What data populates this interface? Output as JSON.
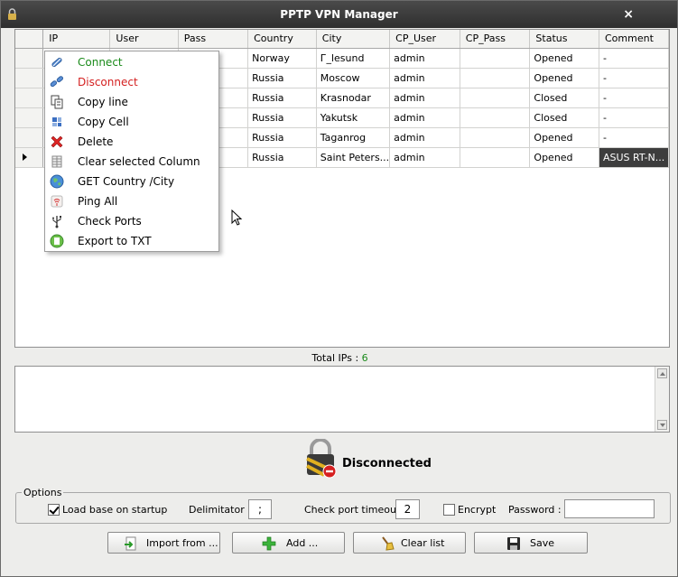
{
  "window": {
    "title": "PPTP VPN Manager",
    "close_glyph": "×"
  },
  "grid": {
    "columns": [
      "IP",
      "User",
      "Pass",
      "Country",
      "City",
      "CP_User",
      "CP_Pass",
      "Status",
      "Comment"
    ],
    "rows": [
      {
        "country": "Norway",
        "city": "Г_lesund",
        "cp_user": "admin",
        "cp_pass": "",
        "status": "Opened",
        "comment": "-"
      },
      {
        "country": "Russia",
        "city": "Moscow",
        "cp_user": "admin",
        "cp_pass": "",
        "status": "Opened",
        "comment": "-"
      },
      {
        "country": "Russia",
        "city": "Krasnodar",
        "cp_user": "admin",
        "cp_pass": "",
        "status": "Closed",
        "comment": "-"
      },
      {
        "country": "Russia",
        "city": "Yakutsk",
        "cp_user": "admin",
        "cp_pass": "",
        "status": "Closed",
        "comment": "-"
      },
      {
        "country": "Russia",
        "city": "Taganrog",
        "cp_user": "admin",
        "cp_pass": "",
        "status": "Opened",
        "comment": "-"
      },
      {
        "country": "Russia",
        "city": "Saint Peters...",
        "cp_user": "admin",
        "cp_pass": "",
        "status": "Opened",
        "comment": "ASUS RT-N..."
      }
    ]
  },
  "context_menu": {
    "items": [
      {
        "label": "Connect",
        "icon": "connect-icon",
        "color": "#1a8a1a"
      },
      {
        "label": "Disconnect",
        "icon": "disconnect-icon",
        "color": "#d42020"
      },
      {
        "label": "Copy line",
        "icon": "copy-line-icon",
        "color": "#000000"
      },
      {
        "label": "Copy Cell",
        "icon": "copy-cell-icon",
        "color": "#000000"
      },
      {
        "label": "Delete",
        "icon": "delete-icon",
        "color": "#000000"
      },
      {
        "label": "Clear selected Column",
        "icon": "clear-column-icon",
        "color": "#000000"
      },
      {
        "label": "GET Country /City",
        "icon": "globe-icon",
        "color": "#000000"
      },
      {
        "label": "Ping All",
        "icon": "ping-icon",
        "color": "#000000"
      },
      {
        "label": "Check Ports",
        "icon": "usb-icon",
        "color": "#000000"
      },
      {
        "label": "Export to TXT",
        "icon": "export-icon",
        "color": "#000000"
      }
    ]
  },
  "summary": {
    "total_label": "Total IPs : ",
    "total_value": "6"
  },
  "status": {
    "text": "Disconnected"
  },
  "options": {
    "legend": "Options",
    "load_base_label": "Load base on startup",
    "load_base_checked": true,
    "delimitator_label": "Delimitator",
    "delimitator_value": ";",
    "timeout_label": "Check port timeout :",
    "timeout_value": "2",
    "encrypt_label": "Encrypt",
    "encrypt_checked": false,
    "password_label": "Password :",
    "password_value": ""
  },
  "buttons": {
    "import": "Import from ...",
    "add": "Add ...",
    "clear": "Clear list",
    "save": "Save"
  }
}
